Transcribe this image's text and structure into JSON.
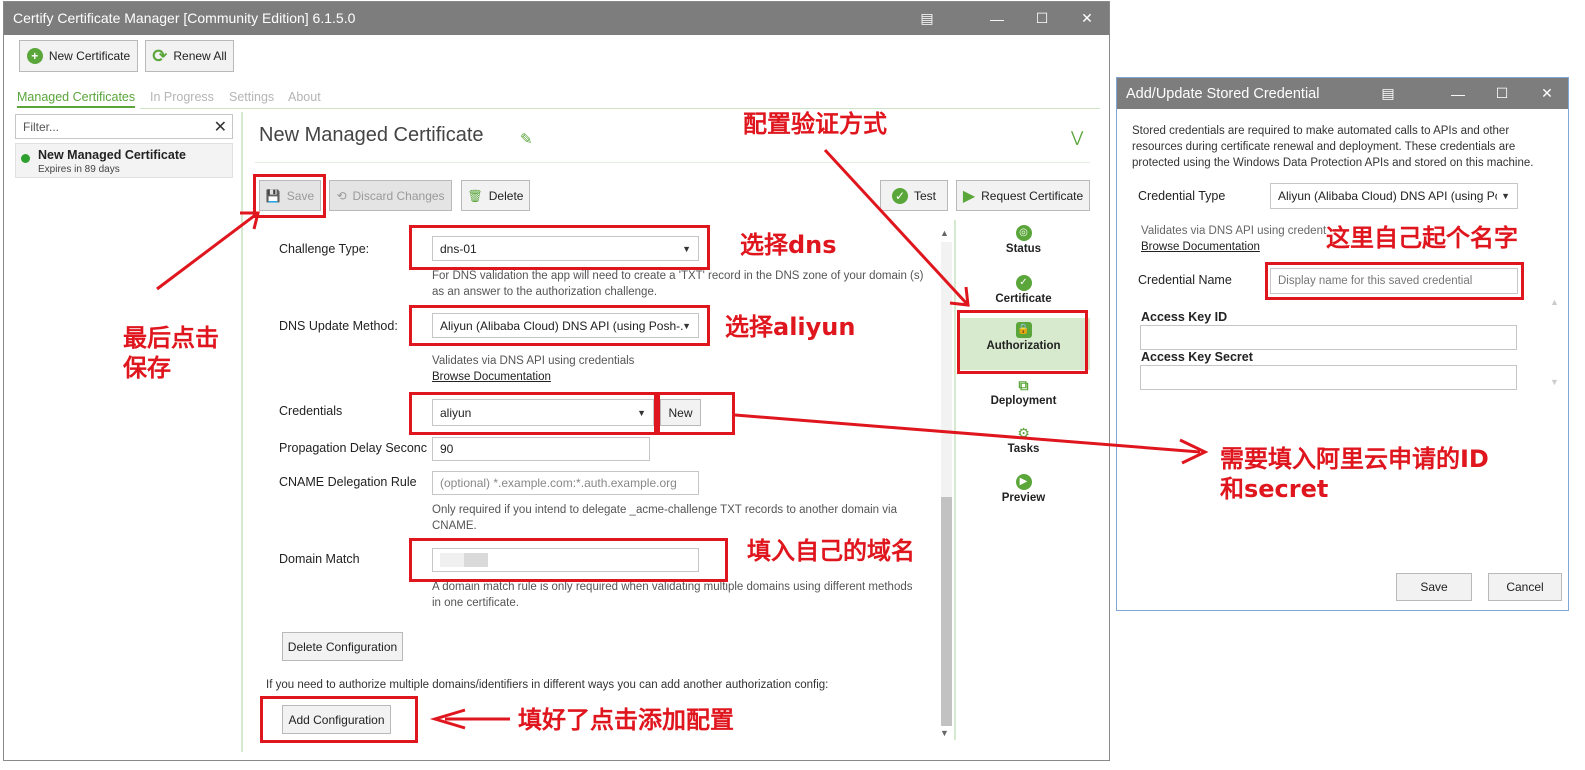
{
  "main_window": {
    "title": "Certify Certificate Manager [Community Edition] 6.1.5.0",
    "toolbar": {
      "new_certificate": "New Certificate",
      "renew_all": "Renew All"
    },
    "tabs": [
      "Managed Certificates",
      "In Progress",
      "Settings",
      "About"
    ],
    "filter_placeholder": "Filter...",
    "list_item": {
      "title": "New Managed Certificate",
      "subtitle": "Expires in 89 days"
    },
    "heading": "New Managed Certificate",
    "actions": {
      "save": "Save",
      "discard": "Discard Changes",
      "delete": "Delete",
      "test": "Test",
      "request": "Request Certificate"
    },
    "form": {
      "challenge_type_label": "Challenge Type:",
      "challenge_type_value": "dns-01",
      "challenge_help": "For DNS validation the app will need to create a 'TXT' record in the DNS zone of your domain (s) as an answer to the authorization challenge.",
      "dns_method_label": "DNS Update Method:",
      "dns_method_value": "Aliyun (Alibaba Cloud) DNS API (using Posh-.",
      "dns_help": "Validates via DNS API using credentials",
      "browse_docs": "Browse Documentation",
      "credentials_label": "Credentials",
      "credentials_value": "aliyun",
      "new_button": "New",
      "propagation_label": "Propagation Delay Seconc",
      "propagation_value": "90",
      "cname_label": "CNAME Delegation Rule",
      "cname_placeholder": "(optional) *.example.com:*.auth.example.org",
      "cname_help": "Only required if you intend to delegate _acme-challenge TXT records to another domain via CNAME.",
      "domain_match_label": "Domain Match",
      "domain_match_help": "A domain match rule is only required when validating multiple domains using different methods in one certificate.",
      "delete_config": "Delete Configuration",
      "multi_help": "If you need to authorize multiple domains/identifiers in different ways you can add another authorization config:",
      "add_config": "Add Configuration"
    },
    "nav": [
      "Status",
      "Certificate",
      "Authorization",
      "Deployment",
      "Tasks",
      "Preview"
    ]
  },
  "dialog": {
    "title": "Add/Update Stored Credential",
    "intro": "Stored credentials are required to make automated calls to APIs and other resources during certificate renewal and deployment. These credentials are protected using the Windows Data Protection APIs and stored on this machine.",
    "credential_type_label": "Credential Type",
    "credential_type_value": "Aliyun (Alibaba Cloud) DNS API (using Pc",
    "validates_text": "Validates via DNS API using credent",
    "browse_docs": "Browse Documentation",
    "credential_name_label": "Credential Name",
    "credential_name_placeholder": "Display name for this saved credential",
    "access_key_id_label": "Access Key ID",
    "access_key_secret_label": "Access Key Secret",
    "save": "Save",
    "cancel": "Cancel"
  },
  "annotations": {
    "configure_method": "配置验证方式",
    "choose_dns": "选择dns",
    "choose_aliyun": "选择aliyun",
    "click_save": "最后点击\n保存",
    "own_name": "这里自己起个名字",
    "fill_id_secret": "需要填入阿里云申请的ID\n和secret",
    "own_domain": "填入自己的域名",
    "add_config": "填好了点击添加配置"
  },
  "colors": {
    "accent": "#5aa63a",
    "annotation": "#e0161e",
    "titlebar": "#7d7d7d"
  }
}
